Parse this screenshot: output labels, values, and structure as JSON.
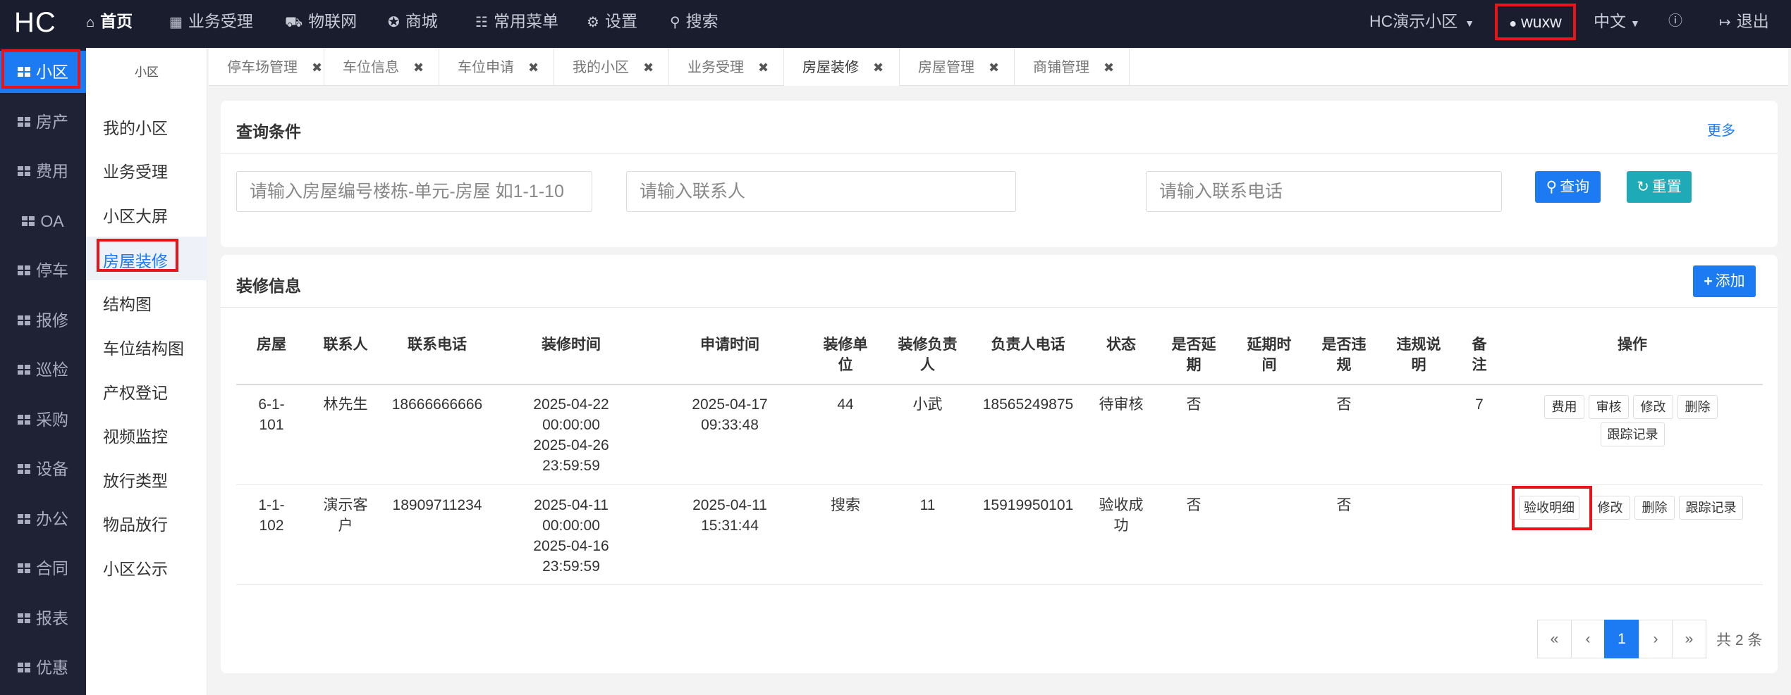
{
  "topnav": {
    "logo": "HC",
    "items": [
      {
        "icon": "home-icon",
        "label": "首页"
      },
      {
        "icon": "table-icon",
        "label": "业务受理"
      },
      {
        "icon": "car-icon",
        "label": "物联网"
      },
      {
        "icon": "cart-icon",
        "label": "商城"
      },
      {
        "icon": "sitemap-icon",
        "label": "常用菜单"
      },
      {
        "icon": "gear-icon",
        "label": "设置"
      },
      {
        "icon": "search-icon",
        "label": "搜索"
      }
    ],
    "community": "HC演示小区",
    "user": "wuxw",
    "language": "中文",
    "help_icon": "question-circle-icon",
    "logout": "退出"
  },
  "leftbar": {
    "items": [
      "小区",
      "房产",
      "费用",
      "OA",
      "停车",
      "报修",
      "巡检",
      "采购",
      "设备",
      "办公",
      "合同",
      "报表",
      "优惠"
    ]
  },
  "subbar": {
    "title": "小区",
    "items": [
      "我的小区",
      "业务受理",
      "小区大屏",
      "房屋装修",
      "结构图",
      "车位结构图",
      "产权登记",
      "视频监控",
      "放行类型",
      "物品放行",
      "小区公示"
    ]
  },
  "tabs": [
    "停车场管理",
    "车位信息",
    "车位申请",
    "我的小区",
    "业务受理",
    "房屋装修",
    "房屋管理",
    "商铺管理"
  ],
  "query": {
    "title": "查询条件",
    "more": "更多",
    "room_placeholder": "请输入房屋编号楼栋-单元-房屋 如1-1-10",
    "contact_placeholder": "请输入联系人",
    "phone_placeholder": "请输入联系电话",
    "search_btn": "查询",
    "reset_btn": "重置"
  },
  "info": {
    "title": "装修信息",
    "add_btn": "添加"
  },
  "table": {
    "headers": [
      "房屋",
      "联系人",
      "联系电话",
      "装修时间",
      "申请时间",
      "装修单位",
      "装修负责人",
      "负责人电话",
      "状态",
      "是否延期",
      "延期时间",
      "是否违规",
      "违规说明",
      "备注",
      "操作"
    ],
    "rows": [
      {
        "room": "6-1-101",
        "contact": "林先生",
        "phone": "18666666666",
        "reno_start": "2025-04-22 00:00:00",
        "reno_end": "2025-04-26 23:59:59",
        "apply_time": "2025-04-17 09:33:48",
        "unit": "44",
        "manager": "小武",
        "manager_phone": "18565249875",
        "status": "待审核",
        "delayed": "否",
        "delay_time": "",
        "violation": "否",
        "violation_desc": "",
        "remark": "7",
        "actions": [
          "费用",
          "审核",
          "修改",
          "删除",
          "跟踪记录"
        ]
      },
      {
        "room": "1-1-102",
        "contact": "演示客户",
        "phone": "18909711234",
        "reno_start": "2025-04-11 00:00:00",
        "reno_end": "2025-04-16 23:59:59",
        "apply_time": "2025-04-11 15:31:44",
        "unit": "搜索",
        "manager": "11",
        "manager_phone": "15919950101",
        "status": "验收成功",
        "delayed": "否",
        "delay_time": "",
        "violation": "否",
        "violation_desc": "",
        "remark": "",
        "actions": [
          "验收明细",
          "修改",
          "删除",
          "跟踪记录"
        ]
      }
    ]
  },
  "pagination": {
    "first": "«",
    "prev": "‹",
    "current": "1",
    "next": "›",
    "last": "»",
    "total": "共 2 条"
  },
  "colors": {
    "accent": "#1c7af2",
    "teal": "#1eaab6",
    "highlight": "#e8141a",
    "nav_bg": "#1a1d2e"
  }
}
